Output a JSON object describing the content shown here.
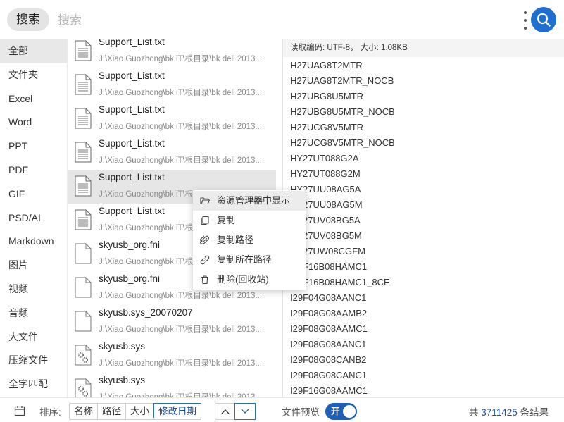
{
  "search": {
    "chip_label": "搜索",
    "placeholder": "搜索",
    "value": ""
  },
  "sidebar": {
    "items": [
      {
        "label": "全部",
        "active": true
      },
      {
        "label": "文件夹"
      },
      {
        "label": "Excel"
      },
      {
        "label": "Word"
      },
      {
        "label": "PPT"
      },
      {
        "label": "PDF"
      },
      {
        "label": "GIF"
      },
      {
        "label": "PSD/AI"
      },
      {
        "label": "Markdown"
      },
      {
        "label": "图片"
      },
      {
        "label": "视频"
      },
      {
        "label": "音频"
      },
      {
        "label": "大文件"
      },
      {
        "label": "压缩文件"
      },
      {
        "label": "全字匹配"
      }
    ]
  },
  "results": [
    {
      "name": "Support_List.txt",
      "path": "J:\\Xiao Guozhong\\bk iT\\根目录\\bk dell 2013...",
      "icon": "text-file-icon"
    },
    {
      "name": "Support_List.txt",
      "path": "J:\\Xiao Guozhong\\bk iT\\根目录\\bk dell 2013...",
      "icon": "text-file-icon"
    },
    {
      "name": "Support_List.txt",
      "path": "J:\\Xiao Guozhong\\bk iT\\根目录\\bk dell 2013...",
      "icon": "text-file-icon"
    },
    {
      "name": "Support_List.txt",
      "path": "J:\\Xiao Guozhong\\bk iT\\根目录\\bk dell 2013...",
      "icon": "text-file-icon"
    },
    {
      "name": "Support_List.txt",
      "path": "J:\\Xiao Guozhong\\bk iT\\根目录\\bk dell 2013...",
      "icon": "text-file-icon",
      "selected": true
    },
    {
      "name": "Support_List.txt",
      "path": "J:\\Xiao Guozhong\\bk iT\\根目录\\bk dell 2013...",
      "icon": "text-file-icon"
    },
    {
      "name": "skyusb_org.fni",
      "path": "J:\\Xiao Guozhong\\bk iT\\根目录\\bk dell 2013...",
      "icon": "blank-file-icon"
    },
    {
      "name": "skyusb_org.fni",
      "path": "J:\\Xiao Guozhong\\bk iT\\根目录\\bk dell 2013...",
      "icon": "blank-file-icon"
    },
    {
      "name": "skyusb.sys_20070207",
      "path": "J:\\Xiao Guozhong\\bk iT\\根目录\\bk dell 2013...",
      "icon": "blank-file-icon"
    },
    {
      "name": "skyusb.sys",
      "path": "J:\\Xiao Guozhong\\bk iT\\根目录\\bk dell 2013...",
      "icon": "system-file-icon"
    },
    {
      "name": "skyusb.sys",
      "path": "J:\\Xiao Guozhong\\bk iT\\根目录\\bk dell 2013...",
      "icon": "system-file-icon"
    }
  ],
  "preview": {
    "header": "读取编码: UTF-8， 大小: 1.08KB",
    "lines": [
      "H27UAG8T2MTR",
      "H27UAG8T2MTR_NOCB",
      "H27UBG8U5MTR",
      "H27UBG8U5MTR_NOCB",
      "H27UCG8V5MTR",
      "H27UCG8V5MTR_NOCB",
      "HY27UT088G2A",
      "HY27UT088G2M",
      "HY27UU08AG5A",
      "HY27UU08AG5M",
      "HY27UV08BG5A",
      "HY27UV08BG5M",
      "HY27UW08CGFM",
      "I29F16B08HAMC1",
      "I29F16B08HAMC1_8CE",
      "I29F04G08AANC1",
      "I29F08G08AAMB2",
      "I29F08G08AAMC1",
      "I29F08G08AANC1",
      "I29F08G08CANB2",
      "I29F08G08CANC1",
      "I29F16G08AAMC1"
    ]
  },
  "context_menu": {
    "items": [
      {
        "label": "资源管理器中显示",
        "icon": "folder-open-icon",
        "hover": true
      },
      {
        "label": "复制",
        "icon": "copy-icon"
      },
      {
        "label": "复制路径",
        "icon": "paperclip-icon"
      },
      {
        "label": "复制所在路径",
        "icon": "link-icon"
      },
      {
        "label": "删除(回收站)",
        "icon": "trash-icon"
      }
    ]
  },
  "footer": {
    "sort_label": "排序:",
    "sort_options": [
      "名称",
      "路径",
      "大小",
      "修改日期"
    ],
    "sort_active": "修改日期",
    "order_active": "descending",
    "preview_label": "文件预览",
    "toggle_text": "开",
    "toggle_on": true,
    "count_prefix": "共",
    "count_value": "3711425",
    "count_suffix": "条结果"
  },
  "colors": {
    "accent": "#1e6fd0",
    "toggle": "#1e5fb8",
    "count_number": "#1d4f9a"
  }
}
